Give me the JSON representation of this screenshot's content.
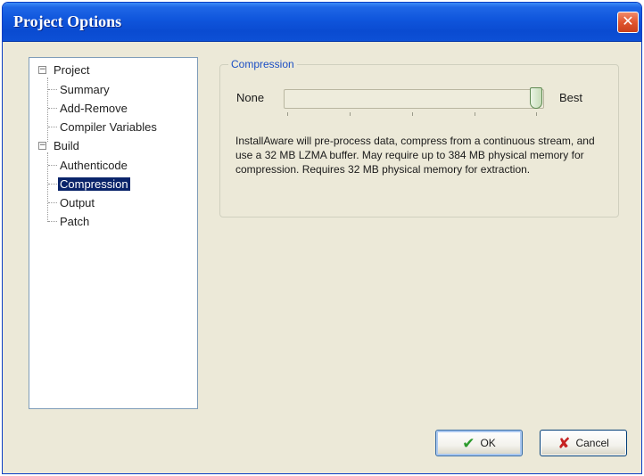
{
  "window": {
    "title": "Project Options",
    "close_glyph": "✕"
  },
  "tree": {
    "project": {
      "label": "Project",
      "expander": "−"
    },
    "project_children": [
      "Summary",
      "Add-Remove",
      "Compiler Variables"
    ],
    "build": {
      "label": "Build",
      "expander": "−"
    },
    "build_children": [
      "Authenticode",
      "Compression",
      "Output",
      "Patch"
    ],
    "selected": "Compression"
  },
  "compression": {
    "group_title": "Compression",
    "min_label": "None",
    "max_label": "Best",
    "level_fraction": 1.0,
    "description": "InstallAware will pre-process data, compress from a continuous stream, and use a 32 MB LZMA buffer. May require up to 384 MB physical memory for compression. Requires 32 MB physical memory for extraction."
  },
  "buttons": {
    "ok_label": "OK",
    "cancel_label": "Cancel"
  },
  "icons": {
    "close": "close-icon",
    "ok": "checkmark-icon",
    "cancel": "x-icon"
  },
  "colors": {
    "titlebar": "#0a4bd1",
    "selection": "#0a246a",
    "group_title": "#1c4fc4"
  }
}
